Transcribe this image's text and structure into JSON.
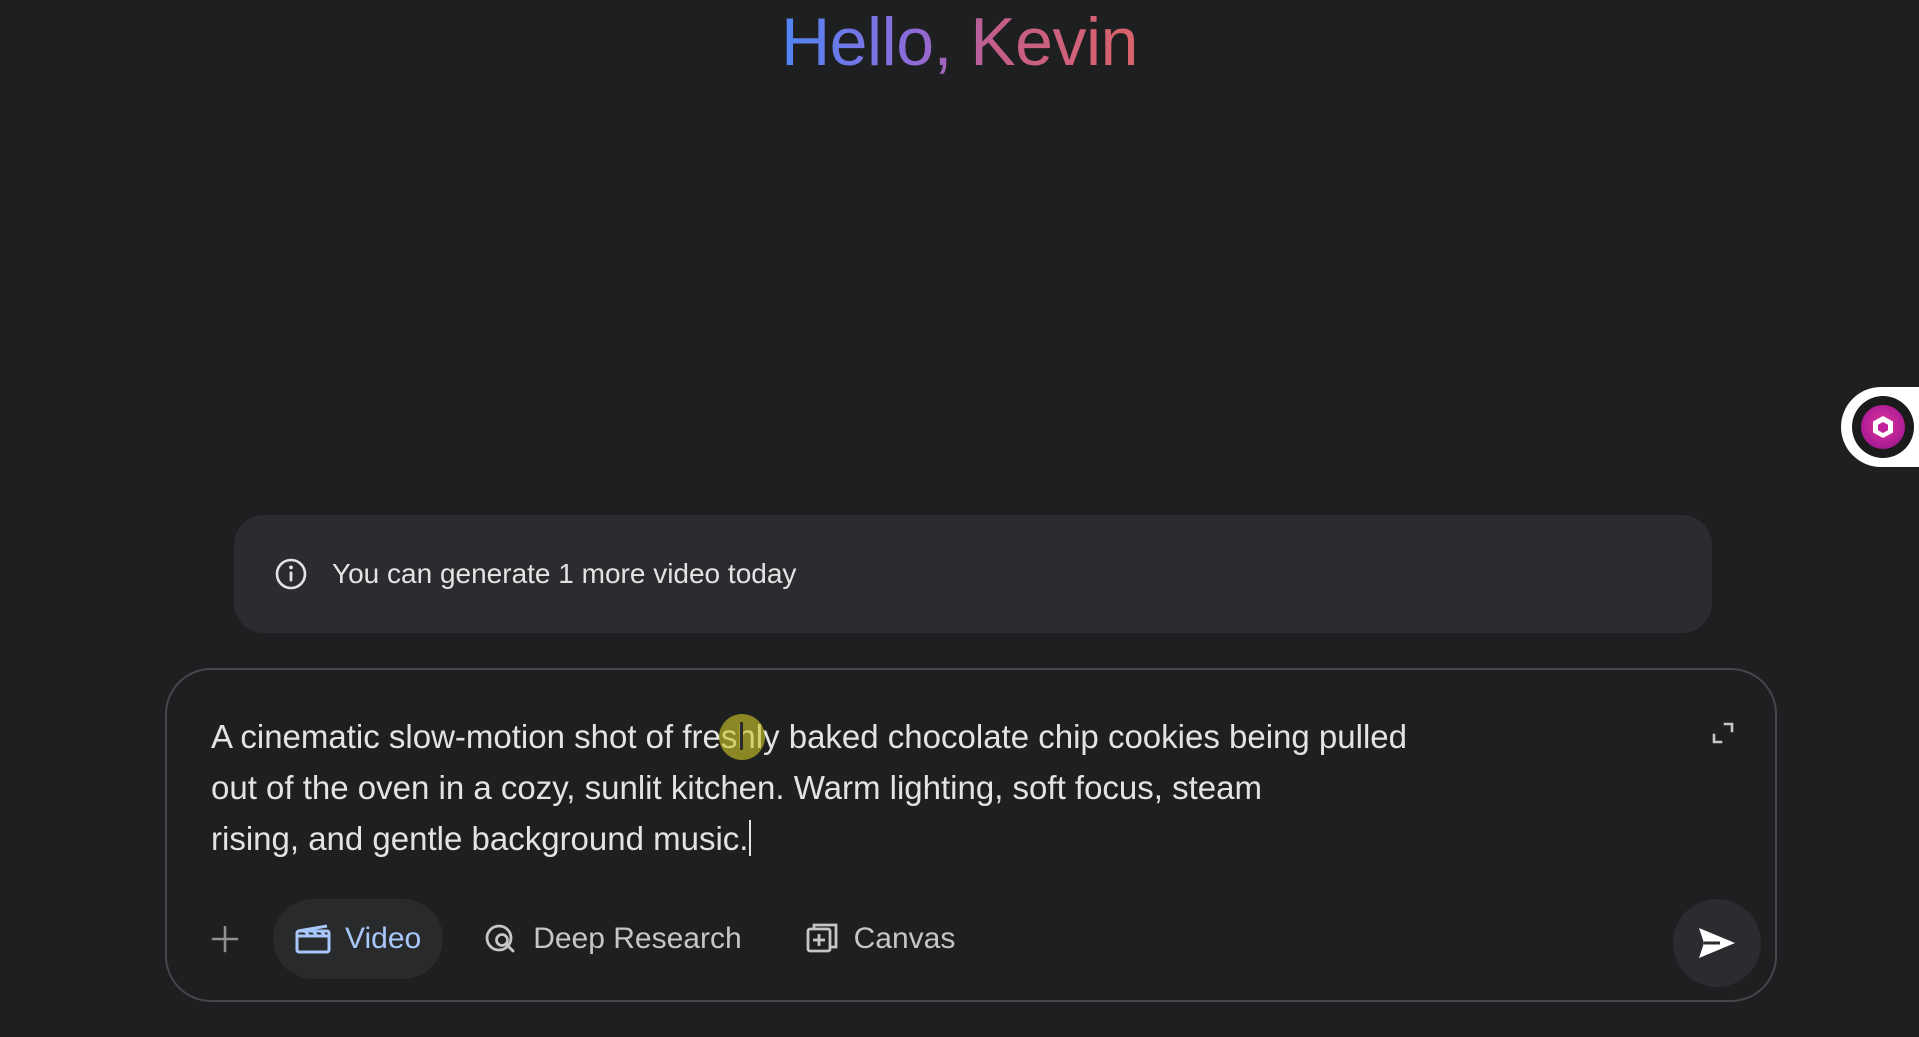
{
  "greeting": {
    "text": "Hello, Kevin"
  },
  "notice": {
    "icon": "info-icon",
    "text": "You can generate 1 more video today"
  },
  "composer": {
    "prompt_text": "A cinematic slow-motion shot of freshly baked chocolate chip cookies being pulled\nout of the oven in a cozy, sunlit kitchen. Warm lighting, soft focus, steam\nrising, and gentle background music.",
    "expand_icon": "expand-icon",
    "tools": {
      "add_icon": "plus-icon",
      "video_label": "Video",
      "deep_research_label": "Deep Research",
      "canvas_label": "Canvas"
    },
    "send_icon": "send-icon"
  },
  "side_widget": {
    "icon": "hexagon-app-icon"
  },
  "colors": {
    "background": "#1e1f20",
    "notice_bg": "#2b2c2f",
    "active_chip_text": "#a8c7fa",
    "gradient_start": "#4f86f7",
    "gradient_end": "#d9636a",
    "widget_accent": "#b21e96"
  }
}
